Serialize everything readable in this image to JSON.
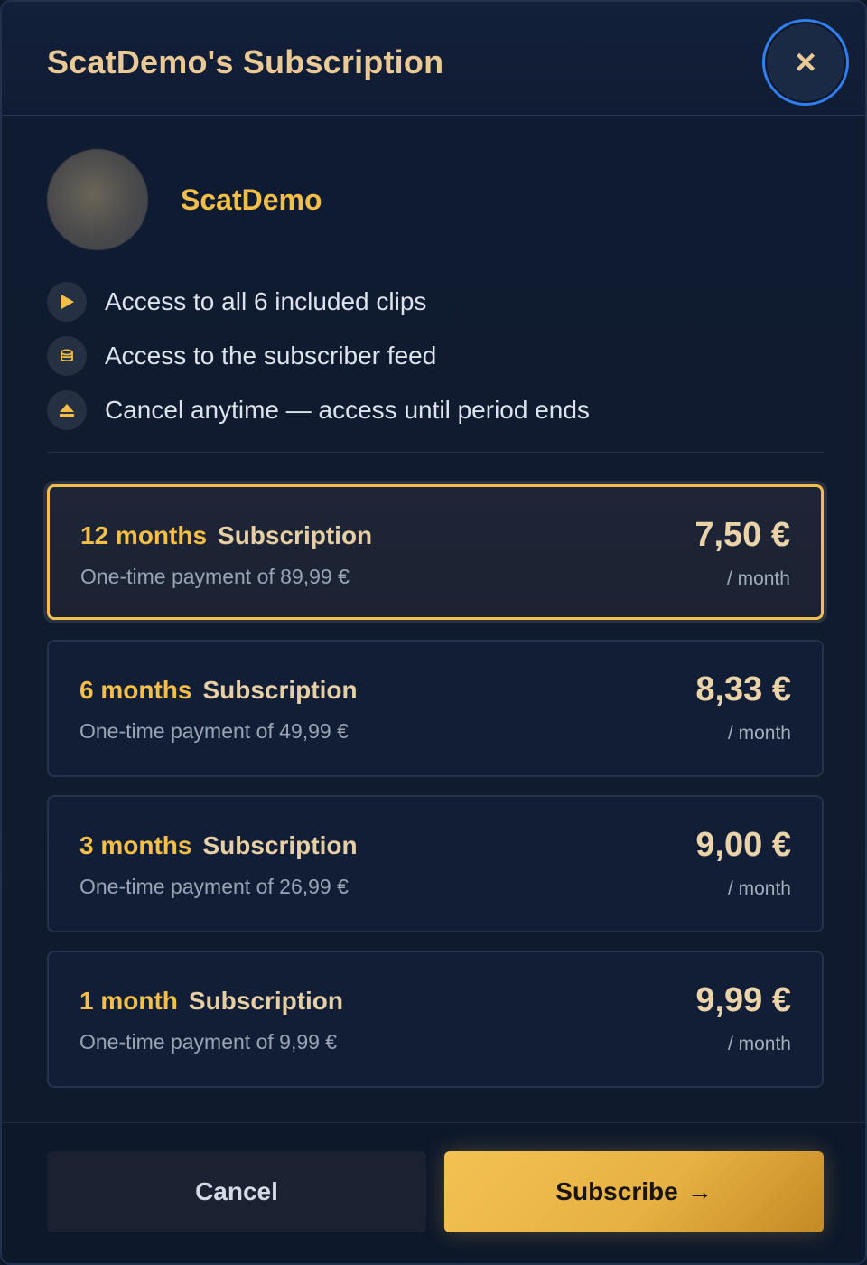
{
  "header": {
    "title": "ScatDemo's Subscription",
    "close_label": "×"
  },
  "profile": {
    "username": "ScatDemo"
  },
  "features": [
    {
      "icon": "play-icon",
      "text": "Access to all 6 included clips"
    },
    {
      "icon": "coins-icon",
      "text": "Access to the subscriber feed"
    },
    {
      "icon": "eject-icon",
      "text": "Cancel anytime — access until period ends"
    }
  ],
  "plans": [
    {
      "duration": "12 months",
      "label": "Subscription",
      "onetime": "One-time payment of 89,99 €",
      "price": "7,50 €",
      "per": "/ month",
      "selected": true
    },
    {
      "duration": "6 months",
      "label": "Subscription",
      "onetime": "One-time payment of 49,99 €",
      "price": "8,33 €",
      "per": "/ month",
      "selected": false
    },
    {
      "duration": "3 months",
      "label": "Subscription",
      "onetime": "One-time payment of 26,99 €",
      "price": "9,00 €",
      "per": "/ month",
      "selected": false
    },
    {
      "duration": "1 month",
      "label": "Subscription",
      "onetime": "One-time payment of 9,99 €",
      "price": "9,99 €",
      "per": "/ month",
      "selected": false
    }
  ],
  "footer": {
    "cancel_label": "Cancel",
    "subscribe_label": "Subscribe",
    "subscribe_arrow": "→"
  },
  "colors": {
    "accent": "#f3bf48",
    "focus_ring": "#2f7ff0",
    "background": "#101b30"
  }
}
